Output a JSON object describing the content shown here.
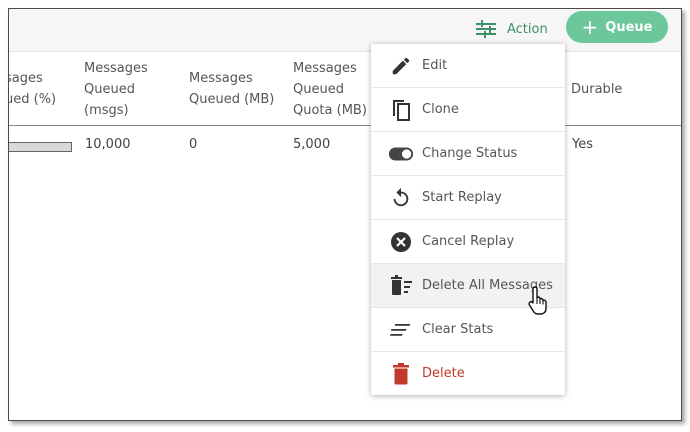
{
  "toolbar": {
    "action_label": "Action",
    "queue_label": "Queue"
  },
  "table": {
    "headers": [
      {
        "lines": [
          "sages",
          "ued (%)"
        ]
      },
      {
        "lines": [
          "Messages",
          "Queued",
          "(msgs)"
        ]
      },
      {
        "lines": [
          "Messages",
          "Queued (MB)"
        ]
      },
      {
        "lines": [
          "Messages",
          "Queued",
          "Quota (MB)"
        ]
      },
      {
        "lines": [
          "Durable"
        ]
      }
    ],
    "row": {
      "usage_fraction": 1.0,
      "queued_msgs": "10,000",
      "queued_mb": "0",
      "quota_mb": "5,000",
      "durable": "Yes"
    }
  },
  "menu": {
    "items": [
      {
        "label": "Edit",
        "icon": "pencil-icon"
      },
      {
        "label": "Clone",
        "icon": "copy-icon"
      },
      {
        "label": "Change Status",
        "icon": "toggle-icon"
      },
      {
        "label": "Start Replay",
        "icon": "replay-icon"
      },
      {
        "label": "Cancel Replay",
        "icon": "cancel-circle-icon"
      },
      {
        "label": "Delete All Messages",
        "icon": "delete-messages-icon"
      },
      {
        "label": "Clear Stats",
        "icon": "clear-lines-icon"
      },
      {
        "label": "Delete",
        "icon": "trash-icon"
      }
    ]
  },
  "colors": {
    "accent": "#6cc79b",
    "action_text": "#3c8f68",
    "danger": "#c0392b"
  }
}
